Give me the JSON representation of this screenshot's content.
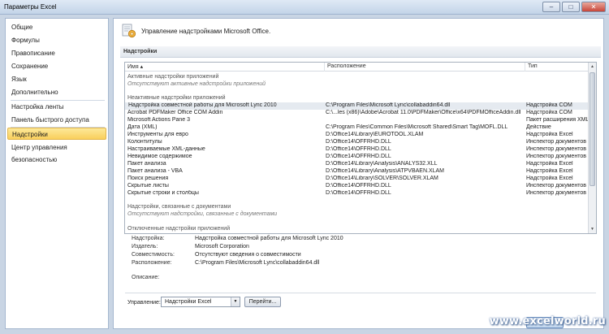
{
  "window": {
    "title": "Параметры Excel",
    "controls": {
      "minimize": "–",
      "maximize": "□",
      "close": "✕"
    }
  },
  "sidebar": {
    "items": [
      {
        "label": "Общие",
        "active": false
      },
      {
        "label": "Формулы",
        "active": false
      },
      {
        "label": "Правописание",
        "active": false
      },
      {
        "label": "Сохранение",
        "active": false
      },
      {
        "label": "Язык",
        "active": false
      },
      {
        "label": "Дополнительно",
        "active": false
      },
      {
        "label": "Настройка ленты",
        "active": false
      },
      {
        "label": "Панель быстрого доступа",
        "active": false
      },
      {
        "label": "Надстройки",
        "active": true
      },
      {
        "label": "Центр управления безопасностью",
        "active": false
      }
    ]
  },
  "main": {
    "header_icon": "addins-gear-icon",
    "header_title": "Управление надстройками Microsoft Office.",
    "section_title": "Надстройки",
    "columns": {
      "name": "Имя ▴",
      "location": "Расположение",
      "type": "Тип"
    },
    "groups": {
      "active": {
        "title": "Активные надстройки приложений",
        "note": "Отсутствуют активные надстройки приложений"
      },
      "inactive": {
        "title": "Неактивные надстройки приложений"
      },
      "document": {
        "title": "Надстройки, связанные с документами",
        "note": "Отсутствуют надстройки, связанные с документами"
      },
      "disabled": {
        "title": "Отключенные надстройки приложений"
      }
    },
    "rows": [
      {
        "name": "Надстройка совместной работы для Microsoft Lync 2010",
        "location": "C:\\Program Files\\Microsoft Lync\\collabaddin64.dll",
        "type": "Надстройка COM",
        "selected": true
      },
      {
        "name": "Acrobat PDFMaker Office COM Addin",
        "location": "C:\\...les (x86)\\Adobe\\Acrobat 11.0\\PDFMaker\\Office\\x64\\PDFMOfficeAddin.dll",
        "type": "Надстройка COM",
        "selected": false
      },
      {
        "name": "Microsoft Actions Pane 3",
        "location": "",
        "type": "Пакет расширения XML",
        "selected": false
      },
      {
        "name": "Дата (XML)",
        "location": "C:\\Program Files\\Common Files\\Microsoft Shared\\Smart Tag\\MOFL.DLL",
        "type": "Действие",
        "selected": false
      },
      {
        "name": "Инструменты для евро",
        "location": "D:\\Office14\\Library\\EUROTOOL.XLAM",
        "type": "Надстройка Excel",
        "selected": false
      },
      {
        "name": "Колонтитулы",
        "location": "D:\\Office14\\OFFRHD.DLL",
        "type": "Инспектор документов",
        "selected": false
      },
      {
        "name": "Настраиваемые XML-данные",
        "location": "D:\\Office14\\OFFRHD.DLL",
        "type": "Инспектор документов",
        "selected": false
      },
      {
        "name": "Невидимое содержимое",
        "location": "D:\\Office14\\OFFRHD.DLL",
        "type": "Инспектор документов",
        "selected": false
      },
      {
        "name": "Пакет анализа",
        "location": "D:\\Office14\\Library\\Analysis\\ANALYS32.XLL",
        "type": "Надстройка Excel",
        "selected": false
      },
      {
        "name": "Пакет анализа - VBA",
        "location": "D:\\Office14\\Library\\Analysis\\ATPVBAEN.XLAM",
        "type": "Надстройка Excel",
        "selected": false
      },
      {
        "name": "Поиск решения",
        "location": "D:\\Office14\\Library\\SOLVER\\SOLVER.XLAM",
        "type": "Надстройка Excel",
        "selected": false
      },
      {
        "name": "Скрытые листы",
        "location": "D:\\Office14\\OFFRHD.DLL",
        "type": "Инспектор документов",
        "selected": false
      },
      {
        "name": "Скрытые строки и столбцы",
        "location": "D:\\Office14\\OFFRHD.DLL",
        "type": "Инспектор документов",
        "selected": false
      }
    ],
    "details": {
      "addin_label": "Надстройка:",
      "addin_value": "Надстройка совместной работы для Microsoft Lync 2010",
      "publisher_label": "Издатель:",
      "publisher_value": "Microsoft Corporation",
      "compat_label": "Совместимость:",
      "compat_value": "Отсутствуют сведения о совместимости",
      "location_label": "Расположение:",
      "location_value": "C:\\Program Files\\Microsoft Lync\\collabaddin64.dll",
      "description_label": "Описание:",
      "description_value": ""
    },
    "manage": {
      "label": "Управление:",
      "selected": "Надстройки Excel",
      "go_label": "Перейти..."
    }
  },
  "watermark": "www.excelworld.ru"
}
